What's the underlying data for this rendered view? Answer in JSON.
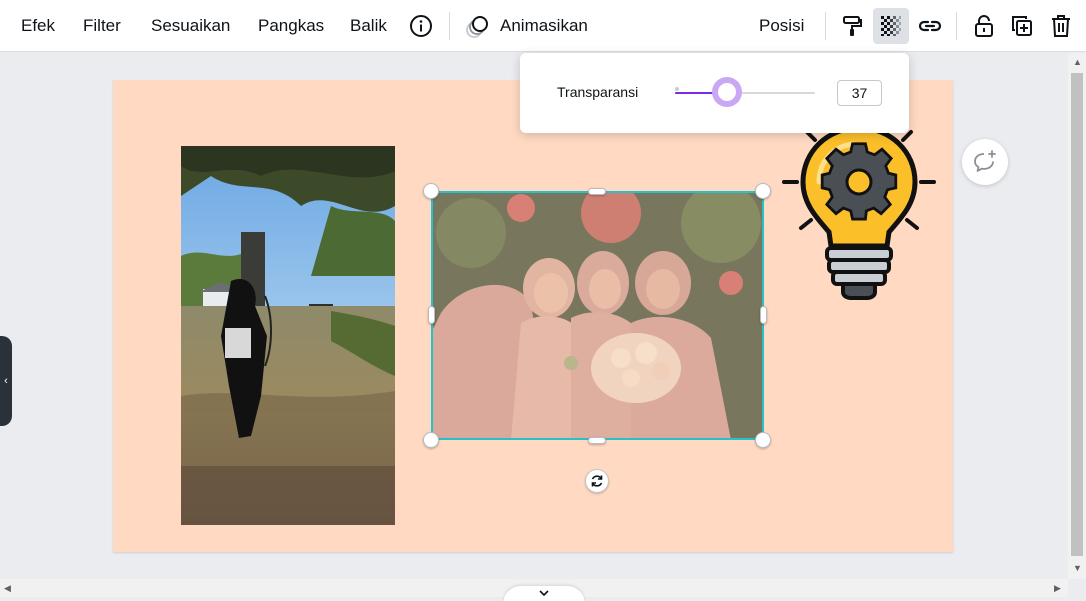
{
  "toolbar": {
    "effects_label": "Efek",
    "filter_label": "Filter",
    "adjust_label": "Sesuaikan",
    "crop_label": "Pangkas",
    "flip_label": "Balik",
    "animate_label": "Animasikan",
    "position_label": "Posisi",
    "icons": [
      "info-icon",
      "animate-icon",
      "paint-roller-icon",
      "transparency-icon",
      "link-icon",
      "lock-icon",
      "duplicate-icon",
      "trash-icon"
    ]
  },
  "transparency": {
    "label": "Transparansi",
    "value": "37",
    "slider_fraction": 0.37
  },
  "colors": {
    "accent": "#7d2ae8",
    "knob": "#c9a7f5",
    "selection": "#26c1c9",
    "page_background": "#ffd9c2",
    "bulb_yellow": "#fbbf2a"
  }
}
